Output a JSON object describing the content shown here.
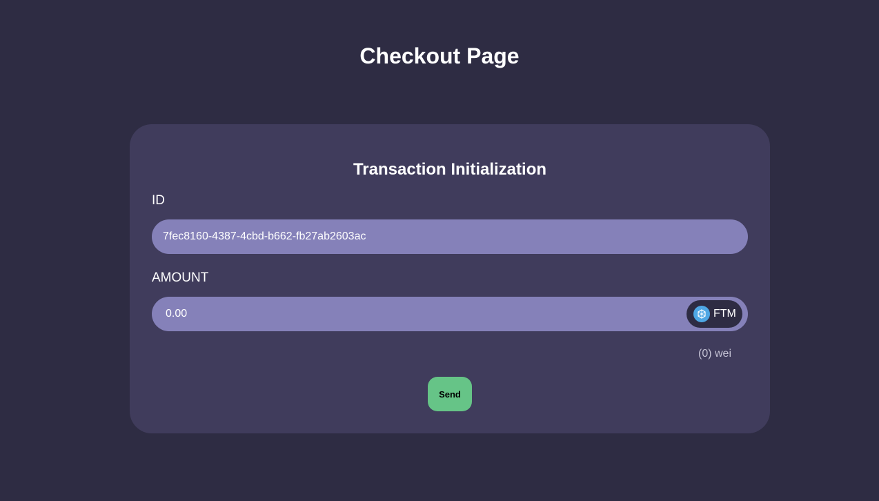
{
  "page": {
    "title": "Checkout Page"
  },
  "card": {
    "title": "Transaction Initialization",
    "id_field": {
      "label": "ID",
      "value": "7fec8160-4387-4cbd-b662-fb27ab2603ac"
    },
    "amount_field": {
      "label": "AMOUNT",
      "placeholder": "0.00",
      "value": ""
    },
    "token": {
      "symbol": "FTM",
      "icon": "fantom-token-icon",
      "icon_color": "#4ea7e4"
    },
    "wei_note": "(0) wei",
    "send_label": "Send"
  },
  "colors": {
    "background": "#2e2c43",
    "card": "#403c5c",
    "input": "#8581b9",
    "send_button": "#66c487"
  }
}
